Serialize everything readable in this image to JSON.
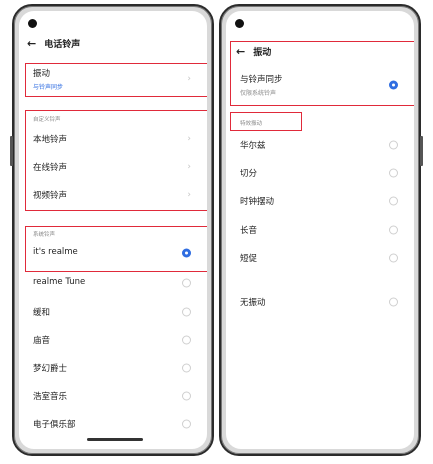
{
  "left_screen": {
    "title": "电话铃声",
    "vibration": {
      "label": "振动",
      "sub": "与铃声同步"
    },
    "custom_section": "自定义铃声",
    "custom_items": [
      "本地铃声",
      "在线铃声",
      "视频铃声"
    ],
    "system_section": "系统铃声",
    "ringtones": [
      "it's realme",
      "realme Tune",
      "缓和",
      "庙音",
      "梦幻爵士",
      "浩室音乐",
      "电子俱乐部"
    ],
    "selected_ringtone": "it's realme"
  },
  "right_screen": {
    "title": "振动",
    "sync": {
      "label": "与铃声同步",
      "sub": "仅限系统铃声"
    },
    "effects_section": "特效振动",
    "effects": [
      "华尔兹",
      "切分",
      "时钟摆动",
      "长音",
      "短促"
    ],
    "none": "无振动"
  },
  "colors": {
    "accent": "#2f6de1",
    "highlight": "#e02a3a"
  }
}
